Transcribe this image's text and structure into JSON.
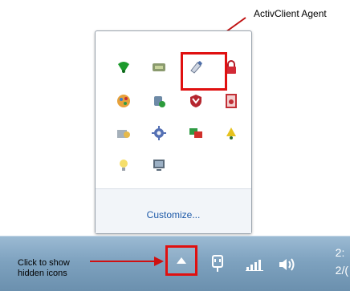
{
  "callouts": {
    "top": "ActivClient Agent",
    "bottom_line1": "Click to show",
    "bottom_line2": "hidden icons"
  },
  "popup": {
    "customize_label": "Customize...",
    "icons": [
      [
        "wifi-icon",
        "chip-icon",
        "activclient-agent-icon",
        "lock-icon"
      ],
      [
        "paint-icon",
        "shield-user-icon",
        "antivirus-shield-icon",
        "document-icon"
      ],
      [
        "network-people-icon",
        "gear-icon",
        "display-icon",
        "bell-icon"
      ],
      [
        "lightbulb-icon",
        "monitor-icon"
      ]
    ]
  },
  "taskbar": {
    "show_hidden_icon": "triangle-up-icon",
    "tray_icons": [
      "power-plug-icon",
      "signal-bars-icon",
      "volume-icon"
    ],
    "clock_line1": "2:",
    "clock_line2": "2/("
  },
  "colors": {
    "highlight": "#e01010",
    "link": "#1e5aa8"
  }
}
